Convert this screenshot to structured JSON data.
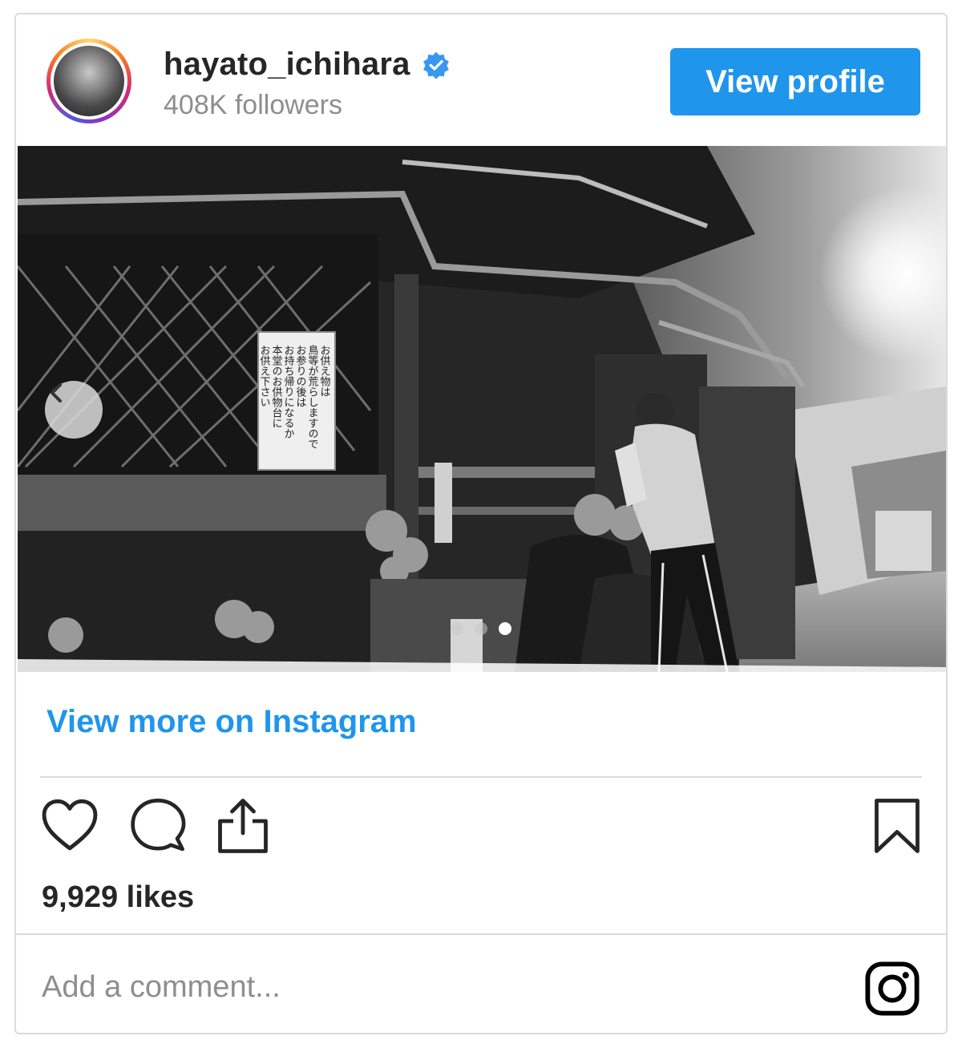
{
  "post": {
    "username": "hayato_ichihara",
    "followers": "408K followers",
    "view_profile_label": "View profile",
    "view_more_label": "View more on Instagram",
    "likes": "9,929 likes",
    "comment_placeholder": "Add a comment...",
    "carousel": {
      "total_slides": 3,
      "active_slide": 3
    }
  },
  "photo": {
    "sign_lines": [
      "お供え物は",
      "鳥等が荒らしますので",
      "お参りの後は",
      "お持ち帰りになるか",
      "本堂のお供物台に",
      "お供え下さい"
    ]
  },
  "icons": [
    "verified-badge-icon",
    "chevron-left-icon",
    "heart-icon",
    "comment-icon",
    "share-icon",
    "bookmark-icon",
    "instagram-icon"
  ],
  "colors": {
    "accent": "#1f95ec",
    "text": "#262626",
    "muted": "#8e8e8e",
    "border": "#dbdbdb"
  }
}
